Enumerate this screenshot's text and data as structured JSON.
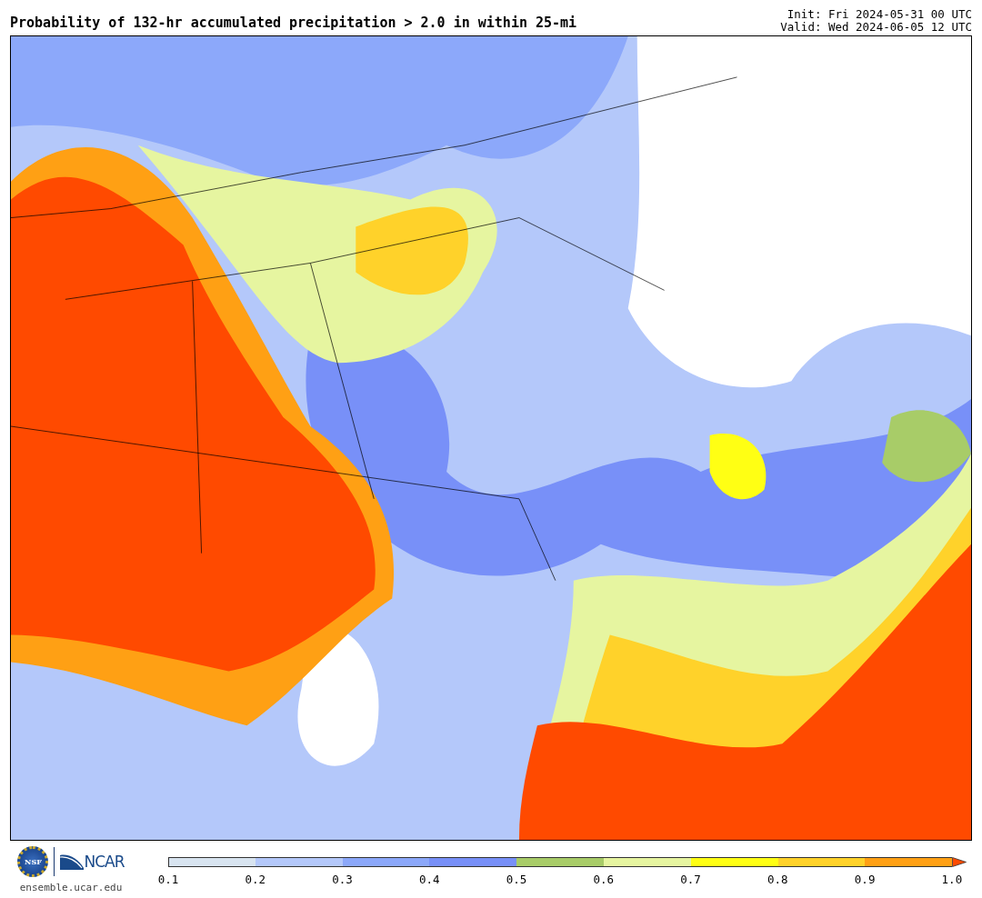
{
  "header": {
    "title": "Probability of 132-hr accumulated precipitation > 2.0 in within 25-mi",
    "init": "Init: Fri 2024-05-31 00 UTC",
    "valid": "Valid: Wed 2024-06-05 12 UTC"
  },
  "footer": {
    "nsf_text": "NSF",
    "ncar_text": "NCAR",
    "url": "ensemble.ucar.edu"
  },
  "colorbar": {
    "bins": [
      {
        "kind": "bar",
        "color": "#d8e4f0"
      },
      {
        "kind": "bar",
        "color": "#b4c8fa"
      },
      {
        "kind": "bar",
        "color": "#8ca8fa"
      },
      {
        "kind": "bar",
        "color": "#7890f8"
      },
      {
        "kind": "bar",
        "color": "#a8cc68"
      },
      {
        "kind": "bar",
        "color": "#e6f5a0"
      },
      {
        "kind": "bar",
        "color": "#ffff14"
      },
      {
        "kind": "bar",
        "color": "#ffd22a"
      },
      {
        "kind": "bar",
        "color": "#ffa014"
      },
      {
        "kind": "arrow",
        "color": "#ff4a00"
      }
    ],
    "ticks": [
      "0.1",
      "0.2",
      "0.3",
      "0.4",
      "0.5",
      "0.6",
      "0.7",
      "0.8",
      "0.9",
      "1.0"
    ]
  }
}
